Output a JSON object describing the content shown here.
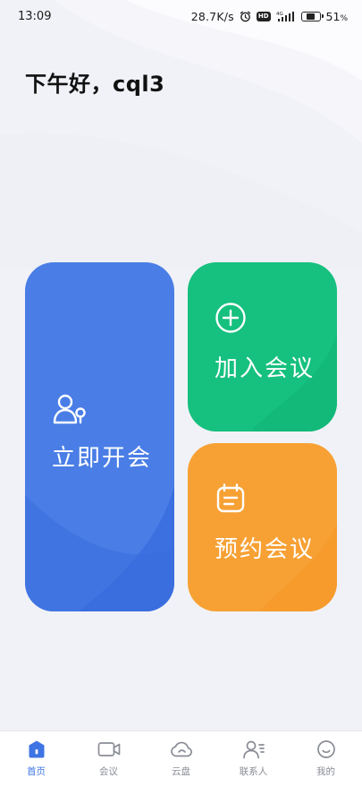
{
  "status_bar": {
    "time": "13:09",
    "network_speed": "28.7K/s",
    "hd_badge": "HD",
    "battery_percent": "51",
    "battery_unit": "%",
    "battery_level": 0.51,
    "signal_label": "4G",
    "icons": [
      "alarm-icon",
      "hd-icon",
      "signal-icon",
      "battery-icon"
    ]
  },
  "greeting": "下午好，cql3",
  "tiles": {
    "start": {
      "label": "立即开会",
      "icon": "person-meeting-icon",
      "color": "#4a7ee6"
    },
    "join": {
      "label": "加入会议",
      "icon": "plus-circle-icon",
      "color": "#16c07e"
    },
    "schedule": {
      "label": "预约会议",
      "icon": "calendar-icon",
      "color": "#f7a135"
    }
  },
  "nav": {
    "accent": "#3e74e4",
    "items": [
      {
        "label": "首页",
        "icon": "home-icon",
        "active": true
      },
      {
        "label": "会议",
        "icon": "video-camera-icon",
        "active": false
      },
      {
        "label": "云盘",
        "icon": "cloud-icon",
        "active": false
      },
      {
        "label": "联系人",
        "icon": "contacts-icon",
        "active": false
      },
      {
        "label": "我的",
        "icon": "smiley-icon",
        "active": false
      }
    ]
  }
}
